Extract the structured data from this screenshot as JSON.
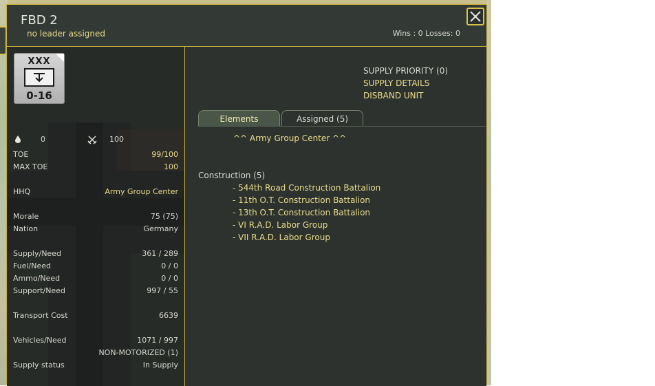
{
  "header": {
    "unit_name": "FBD 2",
    "leader": "no leader assigned",
    "wins_losses": "Wins : 0  Losses: 0"
  },
  "counter": {
    "size": "XXX",
    "strength": "0-16",
    "color": "#c4c4c4"
  },
  "icons": {
    "fort_value": "0",
    "combat_value": "100"
  },
  "stats": [
    {
      "label": "TOE",
      "value": "99/100"
    },
    {
      "label": "MAX TOE",
      "value": "100"
    },
    {
      "label": "HHQ",
      "value": "Army Group Center"
    },
    {
      "label": "Morale",
      "value": "75 (75)"
    },
    {
      "label": "Nation",
      "value": "Germany"
    },
    {
      "label": "Supply/Need",
      "value": "361 / 289"
    },
    {
      "label": "Fuel/Need",
      "value": "0 / 0"
    },
    {
      "label": "Ammo/Need",
      "value": "0 / 0"
    },
    {
      "label": "Support/Need",
      "value": "997 / 55"
    },
    {
      "label": "Transport Cost",
      "value": "6639"
    },
    {
      "label": "Vehicles/Need",
      "value": "1071 / 997"
    },
    {
      "label": "",
      "value": "NON-MOTORIZED (1)"
    },
    {
      "label": "Supply status",
      "value": "In Supply"
    }
  ],
  "actions": {
    "supply_priority": "SUPPLY PRIORITY (0)",
    "supply_details": "SUPPLY DETAILS",
    "disband": "DISBAND UNIT"
  },
  "tabs": [
    {
      "label": "Elements"
    },
    {
      "label": "Assigned (5)"
    }
  ],
  "assigned": {
    "hq_line": "^^  Army Group Center  ^^",
    "group_header": "Construction (5)",
    "elements": [
      "- 544th Road Construction Battalion",
      "- 11th O.T. Construction Battalion",
      "- 13th O.T. Construction Battalion",
      "- VI R.A.D. Labor Group",
      "- VII R.A.D. Labor Group"
    ]
  },
  "colors": {
    "accent": "#c9b13c",
    "highlight_text": "#e8dc8a",
    "panel_bg": "#2b302d"
  }
}
